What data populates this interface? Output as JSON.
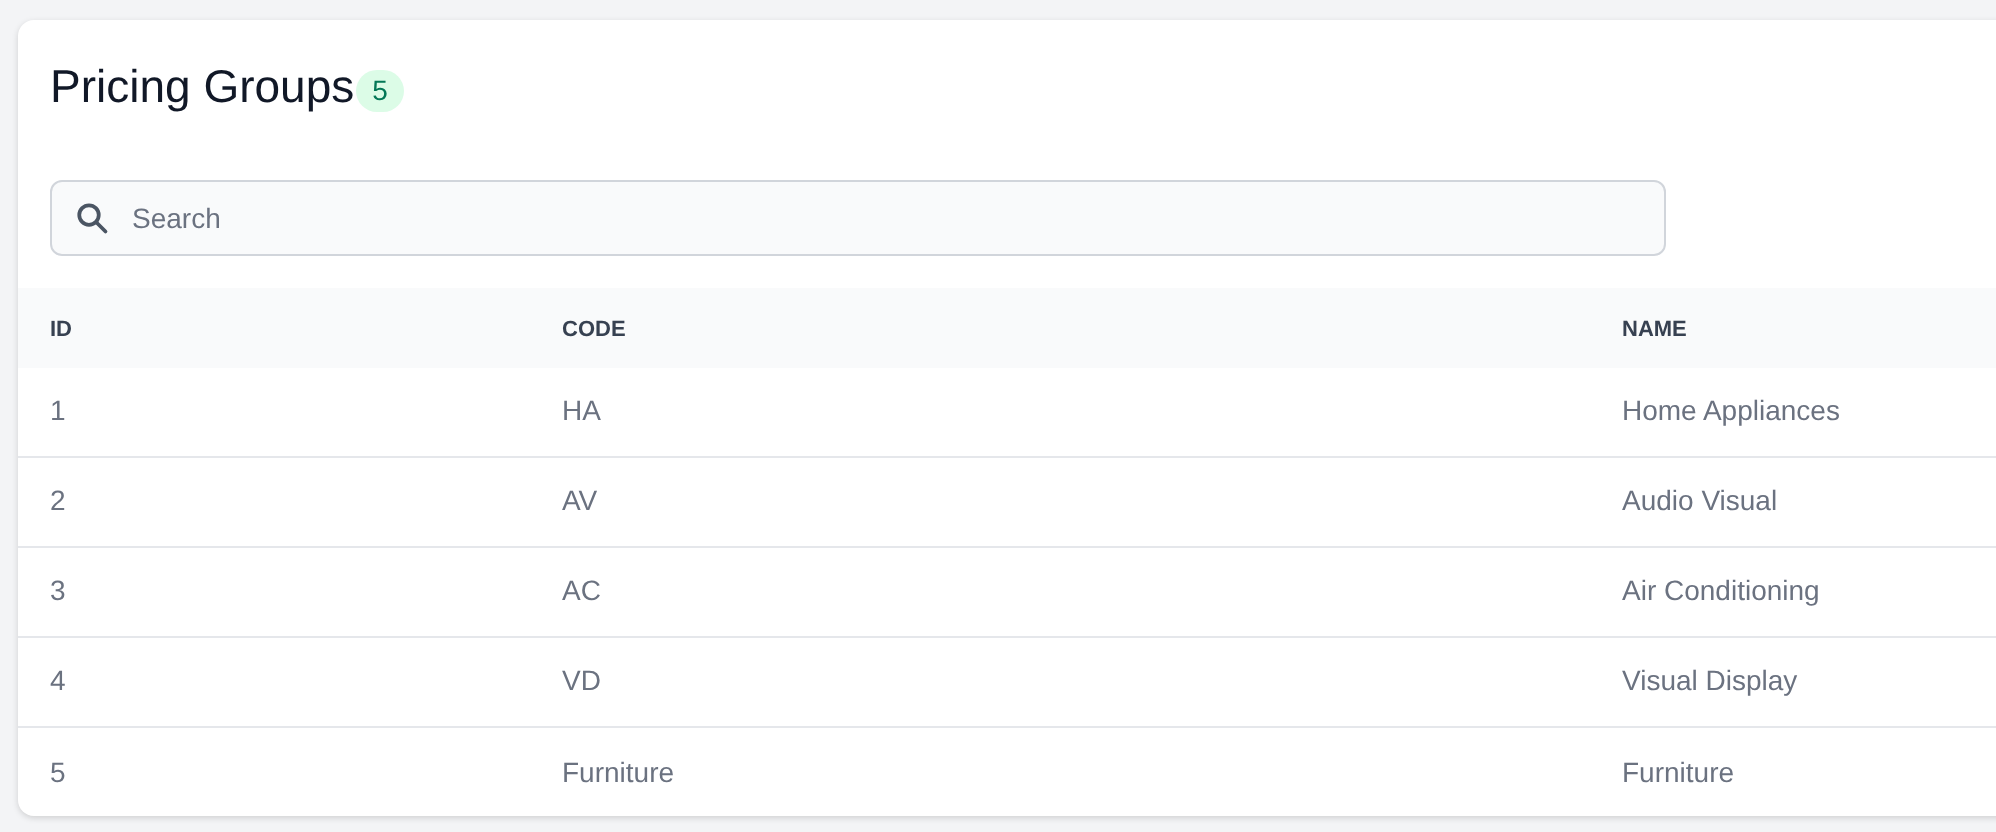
{
  "title": "Pricing Groups",
  "count": "5",
  "search": {
    "placeholder": "Search"
  },
  "table": {
    "columns": [
      "ID",
      "CODE",
      "NAME"
    ],
    "rows": [
      [
        "1",
        "HA",
        "Home Appliances"
      ],
      [
        "2",
        "AV",
        "Audio Visual"
      ],
      [
        "3",
        "AC",
        "Air Conditioning"
      ],
      [
        "4",
        "VD",
        "Visual Display"
      ],
      [
        "5",
        "Furniture",
        "Furniture"
      ]
    ]
  }
}
